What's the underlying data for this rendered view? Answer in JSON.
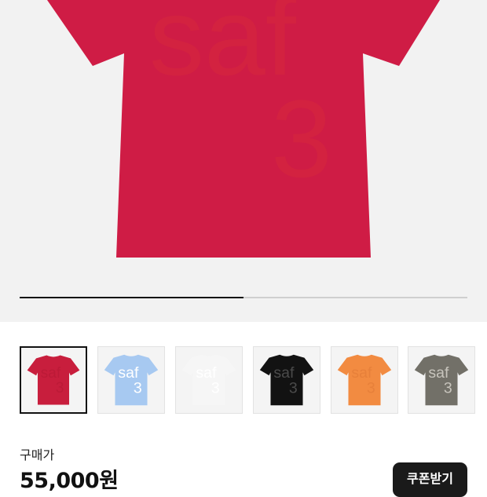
{
  "product": {
    "hero": {
      "color": "#cf1c45",
      "print_line1": "saf",
      "print_line2": "3"
    },
    "carousel_progress": 0.5
  },
  "thumbnails": [
    {
      "color": "#c81e3d",
      "print_color": "#bc1a37",
      "selected": true,
      "label1": "saf",
      "label2": "3"
    },
    {
      "color": "#a7c9f1",
      "print_color": "#ffffff",
      "selected": false,
      "label1": "saf",
      "label2": "3"
    },
    {
      "color": "#f6f6f6",
      "print_color": "#ffffff",
      "selected": false,
      "label1": "saf",
      "label2": "3"
    },
    {
      "color": "#121212",
      "print_color": "#4a4a4a",
      "selected": false,
      "label1": "saf",
      "label2": "3"
    },
    {
      "color": "#f28b41",
      "print_color": "#e7803a",
      "selected": false,
      "label1": "saf",
      "label2": "3"
    },
    {
      "color": "#727068",
      "print_color": "#c7c4bc",
      "selected": false,
      "label1": "saf",
      "label2": "3"
    }
  ],
  "price": {
    "label": "구매가",
    "value": "55,000원"
  },
  "coupon_button": {
    "label": "쿠폰받기"
  }
}
